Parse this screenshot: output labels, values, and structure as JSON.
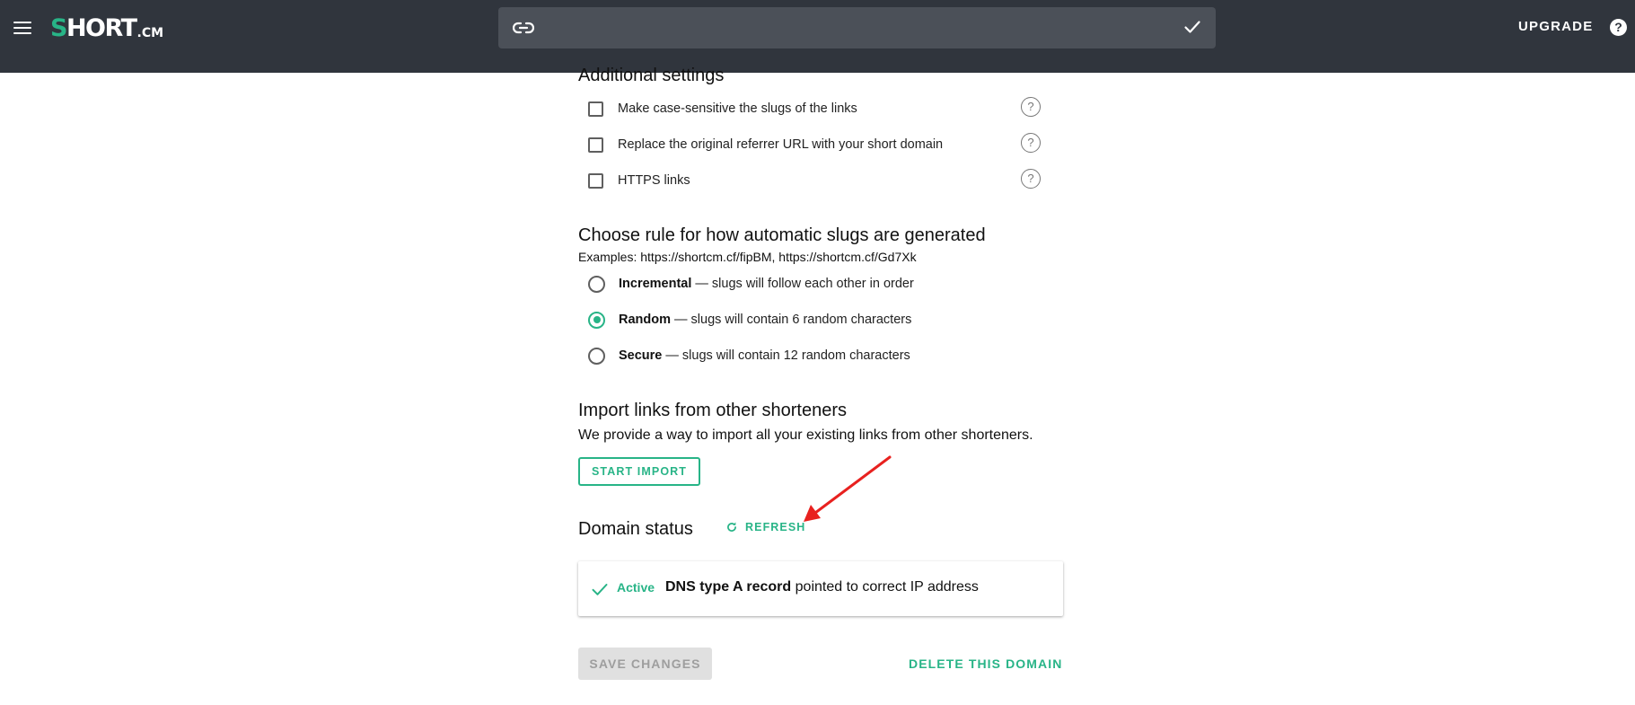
{
  "header": {
    "logo_main": "HORT",
    "logo_s": "S",
    "logo_sub": ".CM",
    "url_value": "",
    "upgrade_label": "UPGRADE",
    "help_label": "?"
  },
  "additional_settings": {
    "title": "Additional settings",
    "options": [
      {
        "label": "Make case-sensitive the slugs of the links",
        "checked": false
      },
      {
        "label": "Replace the original referrer URL with your short domain",
        "checked": false
      },
      {
        "label": "HTTPS links",
        "checked": false
      }
    ],
    "help_glyph": "?"
  },
  "slug_rule": {
    "title": "Choose rule for how automatic slugs are generated",
    "examples": "Examples: https://shortcm.cf/fipBM, https://shortcm.cf/Gd7Xk",
    "options": [
      {
        "name": "Incremental",
        "desc": "— slugs will follow each other in order",
        "selected": false
      },
      {
        "name": "Random",
        "desc": "— slugs will contain 6 random characters",
        "selected": true
      },
      {
        "name": "Secure",
        "desc": "— slugs will contain 12 random characters",
        "selected": false
      }
    ]
  },
  "import": {
    "title": "Import links from other shorteners",
    "description": "We provide a way to import all your existing links from other shorteners.",
    "button_label": "START IMPORT"
  },
  "domain_status": {
    "title": "Domain status",
    "refresh_label": "REFRESH",
    "status_label": "Active",
    "record_bold": "DNS type A record",
    "record_rest": "pointed to correct IP address"
  },
  "footer": {
    "save_label": "SAVE CHANGES",
    "delete_label": "DELETE THIS DOMAIN"
  },
  "colors": {
    "topbar": "#30353d",
    "accent": "#28b487",
    "annotation_arrow": "#e8211f"
  }
}
